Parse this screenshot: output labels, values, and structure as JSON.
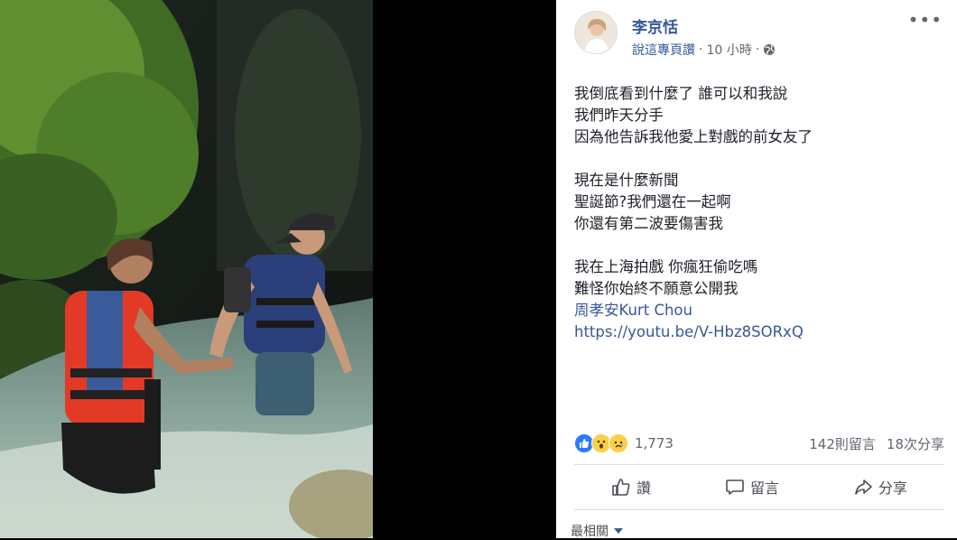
{
  "post": {
    "author": "李京恬",
    "meta_link": "說這專頁讚",
    "meta_sep": "·",
    "time": "10 小時",
    "more": "•••",
    "lines": [
      {
        "text": "我倒底看到什麼了 誰可以和我說",
        "type": "text"
      },
      {
        "text": "我們昨天分手",
        "type": "text"
      },
      {
        "text": "因為他告訴我他愛上對戲的前女友了",
        "type": "text"
      },
      {
        "text": "",
        "type": "blank"
      },
      {
        "text": "現在是什麼新聞",
        "type": "text"
      },
      {
        "text": "聖誕節?我們還在一起啊",
        "type": "text"
      },
      {
        "text": "你還有第二波要傷害我",
        "type": "text"
      },
      {
        "text": "",
        "type": "blank"
      },
      {
        "text": "我在上海拍戲 你瘋狂偷吃嗎",
        "type": "text"
      },
      {
        "text": "難怪你始終不願意公開我",
        "type": "text"
      },
      {
        "text": "周孝安Kurt Chou",
        "type": "tag"
      },
      {
        "text": "https://youtu.be/V-Hbz8SORxQ",
        "type": "tag"
      }
    ]
  },
  "stats": {
    "reactions": "1,773",
    "comments": "142則留言",
    "shares": "18次分享"
  },
  "actions": {
    "like": "讚",
    "comment": "留言",
    "share": "分享"
  },
  "comments_sort": {
    "label": "最相關"
  },
  "colors": {
    "link": "#365899",
    "text": "#1d2129",
    "like_blue": "#2e7cf6"
  }
}
